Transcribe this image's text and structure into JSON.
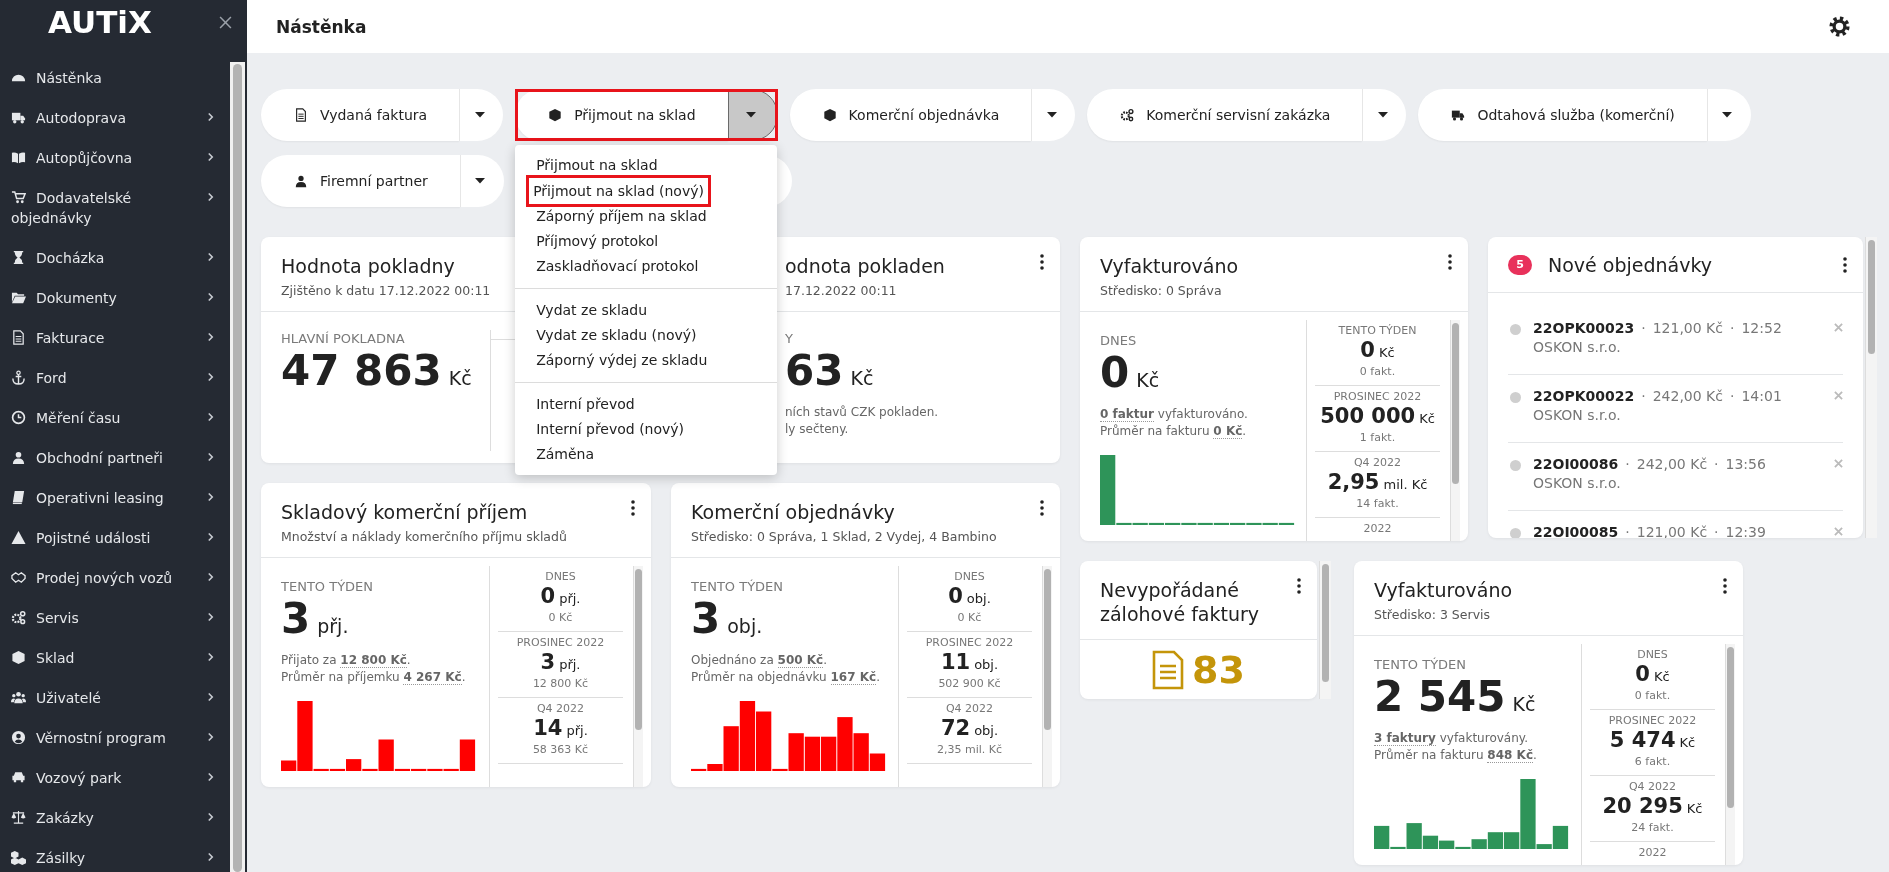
{
  "sidebar": {
    "logo": "AUTiX",
    "items": [
      {
        "label": "Nástěnka",
        "expandable": false
      },
      {
        "label": "Autodoprava",
        "expandable": true
      },
      {
        "label": "Autopůjčovna",
        "expandable": true
      },
      {
        "label": "Dodavatelské objednávky",
        "expandable": true
      },
      {
        "label": "Docházka",
        "expandable": true
      },
      {
        "label": "Dokumenty",
        "expandable": true
      },
      {
        "label": "Fakturace",
        "expandable": true
      },
      {
        "label": "Ford",
        "expandable": true
      },
      {
        "label": "Měření času",
        "expandable": true
      },
      {
        "label": "Obchodní partneři",
        "expandable": true
      },
      {
        "label": "Operativni leasing",
        "expandable": true
      },
      {
        "label": "Pojistné události",
        "expandable": true
      },
      {
        "label": "Prodej nových vozů",
        "expandable": true
      },
      {
        "label": "Servis",
        "expandable": true
      },
      {
        "label": "Sklad",
        "expandable": true
      },
      {
        "label": "Uživatelé",
        "expandable": true
      },
      {
        "label": "Věrnostní program",
        "expandable": true
      },
      {
        "label": "Vozový park",
        "expandable": true
      },
      {
        "label": "Zakázky",
        "expandable": true
      },
      {
        "label": "Zásilky",
        "expandable": true
      }
    ]
  },
  "header": {
    "title": "Nástěnka"
  },
  "quick_actions": [
    {
      "label": "Vydaná faktura",
      "open": false,
      "highlighted": false
    },
    {
      "label": "Přijmout na sklad",
      "open": true,
      "highlighted": true
    },
    {
      "label": "Komerční objednávka",
      "open": false,
      "highlighted": false
    },
    {
      "label": "Komerční servisní zakázka",
      "open": false,
      "highlighted": false
    },
    {
      "label": "Odtahová služba (komerční)",
      "open": false,
      "highlighted": false
    },
    {
      "label": "Firemní partner",
      "open": false,
      "highlighted": false
    },
    {
      "open": false,
      "highlighted": false
    }
  ],
  "dropdown_menu": {
    "groups": [
      {
        "items": [
          {
            "label": "Přijmout na sklad",
            "highlighted": false
          },
          {
            "label": "Přijmout na sklad (nový)",
            "highlighted": true
          },
          {
            "label": "Záporný příjem na sklad",
            "highlighted": false
          },
          {
            "label": "Příjmový protokol",
            "highlighted": false
          },
          {
            "label": "Zaskladňovací protokol",
            "highlighted": false
          }
        ]
      },
      {
        "items": [
          {
            "label": "Vydat ze skladu",
            "highlighted": false
          },
          {
            "label": "Vydat ze skladu (nový)",
            "highlighted": false
          },
          {
            "label": "Záporný výdej ze skladu",
            "highlighted": false
          }
        ]
      },
      {
        "items": [
          {
            "label": "Interní převod",
            "highlighted": false
          },
          {
            "label": "Interní převod (nový)",
            "highlighted": false
          },
          {
            "label": "Záměna",
            "highlighted": false
          }
        ]
      }
    ]
  },
  "cards": [
    {
      "kind": "cash",
      "title": "Hodnota pokladny",
      "subtitle": "Zjištěno k datu 17.12.2022 00:11",
      "main": {
        "label": "HLAVNÍ POKLADNA",
        "value": "47 863",
        "unit": "Kč"
      }
    },
    {
      "kind": "cash_partial",
      "title": "odnota pokladen",
      "subtitle": "17.12.2022 00:11",
      "main": {
        "label": "Y",
        "value": "63",
        "unit": "Kč",
        "lines": [
          "ních stavů CZK pokladen.",
          "ly sečteny."
        ]
      }
    },
    {
      "kind": "stats",
      "title": "Vyfakturováno",
      "subtitle": "Středisko: 0 Správa",
      "color": "#2e9459",
      "main": {
        "label": "DNES",
        "value": "0",
        "unit": "Kč",
        "lines": [
          "**0 faktur** vyfakturováno.",
          "Průměr na fakturu **0 Kč**."
        ]
      },
      "periods": [
        {
          "label": "TENTO TÝDEN",
          "value": "0",
          "unit": "Kč",
          "sub": "0 fakt."
        },
        {
          "label": "PROSINEC 2022",
          "value": "500 000",
          "unit": "Kč",
          "sub": "1 fakt."
        },
        {
          "label": "Q4 2022",
          "value": "2,95",
          "unit": "mil. Kč",
          "sub": "14 fakt."
        },
        {
          "label": "2022"
        }
      ]
    },
    {
      "kind": "orders",
      "badge": "5",
      "title": "Nové objednávky",
      "separator": "·",
      "items": [
        {
          "number": "22OPK00023",
          "amount": "121,00 Kč",
          "time": "12:52",
          "partner": "OSKON s.r.o."
        },
        {
          "number": "22OPK00022",
          "amount": "242,00 Kč",
          "time": "14:01",
          "partner": "OSKON s.r.o."
        },
        {
          "number": "22OI00086",
          "amount": "242,00 Kč",
          "time": "13:56",
          "partner": "OSKON s.r.o."
        },
        {
          "number": "22OI00085",
          "amount": "121,00 Kč",
          "time": "12:39"
        }
      ]
    },
    {
      "kind": "stats",
      "title": "Skladový komerční příjem",
      "subtitle": "Množství a náklady komerčního příjmu skladů",
      "color": "#ff0000",
      "main": {
        "label": "TENTO TÝDEN",
        "value": "3",
        "unit": "přj.",
        "lines": [
          "Přijato za **12 800 Kč**.",
          "Průměr na příjemku **4 267 Kč**."
        ]
      },
      "periods": [
        {
          "label": "DNES",
          "value": "0",
          "unit": "přj.",
          "sub": "0 Kč"
        },
        {
          "label": "PROSINEC 2022",
          "value": "3",
          "unit": "přj.",
          "sub": "12 800 Kč"
        },
        {
          "label": "Q4 2022",
          "value": "14",
          "unit": "přj.",
          "sub": "58 363 Kč"
        }
      ]
    },
    {
      "kind": "stats",
      "title": "Komerční objednávky",
      "subtitle": "Středisko: 0 Správa, 1 Sklad, 2 Vydej, 4 Bambino",
      "color": "#ff0000",
      "main": {
        "label": "TENTO TÝDEN",
        "value": "3",
        "unit": "obj.",
        "lines": [
          "Objednáno za **500 Kč**.",
          "Průměr na objednávku **167 Kč**."
        ]
      },
      "periods": [
        {
          "label": "DNES",
          "value": "0",
          "unit": "obj.",
          "sub": "0 Kč"
        },
        {
          "label": "PROSINEC 2022",
          "value": "11",
          "unit": "obj.",
          "sub": "502 900 Kč"
        },
        {
          "label": "Q4 2022",
          "value": "72",
          "unit": "obj.",
          "sub": "2,35 mil. Kč"
        }
      ]
    },
    {
      "kind": "count",
      "title": "Nevypořádané zálohové faktury",
      "count": "83"
    },
    {
      "kind": "stats",
      "title": "Vyfakturováno",
      "subtitle": "Středisko: 3 Servis",
      "color": "#2e9459",
      "main": {
        "label": "TENTO TÝDEN",
        "value": "2 545",
        "unit": "Kč",
        "lines": [
          "**3 faktury** vyfakturovány.",
          "Průměr na fakturu **848 Kč**."
        ]
      },
      "periods": [
        {
          "label": "DNES",
          "value": "0",
          "unit": "Kč",
          "sub": "0 fakt."
        },
        {
          "label": "PROSINEC 2022",
          "value": "5 474",
          "unit": "Kč",
          "sub": "6 fakt."
        },
        {
          "label": "Q4 2022",
          "value": "20 295",
          "unit": "Kč",
          "sub": "24 fakt."
        },
        {
          "label": "2022"
        }
      ]
    }
  ]
}
